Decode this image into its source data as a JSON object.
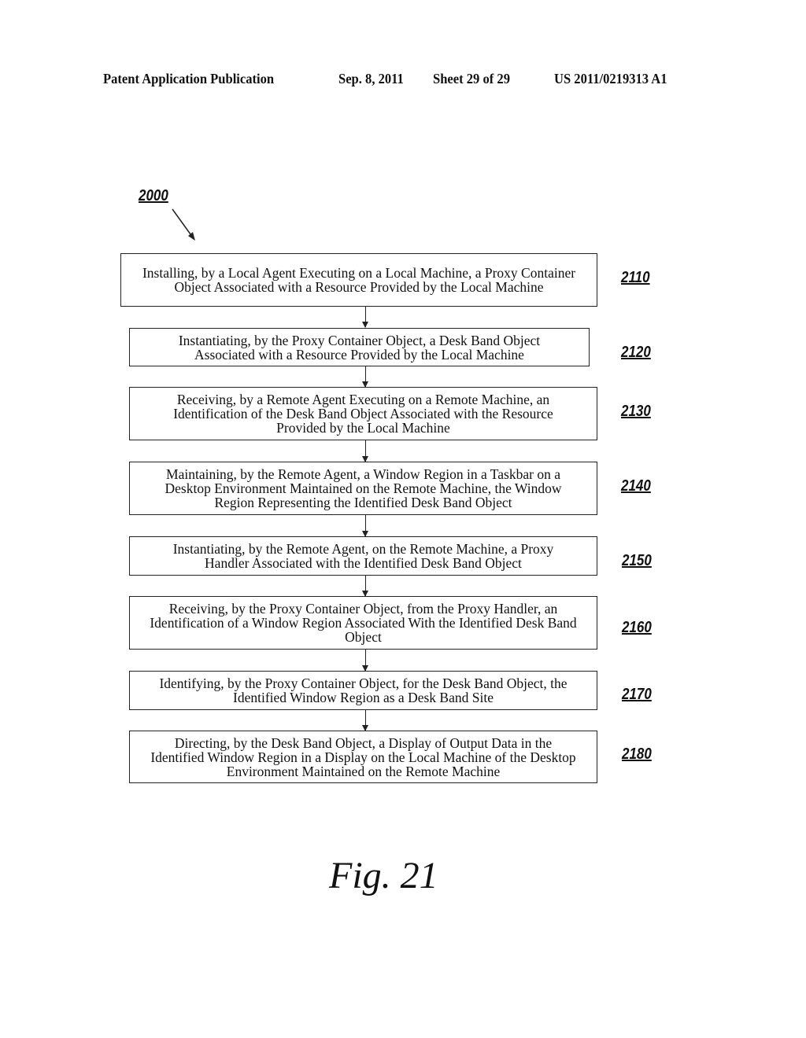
{
  "header": {
    "publication": "Patent Application Publication",
    "date": "Sep. 8, 2011",
    "sheet": "Sheet 29 of 29",
    "number": "US 2011/0219313 A1"
  },
  "diagram": {
    "start_ref": "2000",
    "steps": [
      {
        "ref": "2110",
        "text": "Installing, by a Local Agent Executing on a Local Machine, a Proxy Container Object Associated with a Resource Provided by the Local Machine"
      },
      {
        "ref": "2120",
        "text": "Instantiating, by the Proxy Container Object, a Desk Band Object Associated with a Resource Provided by the Local Machine"
      },
      {
        "ref": "2130",
        "text": "Receiving, by a Remote Agent Executing on a Remote Machine, an Identification of the Desk Band Object Associated with the Resource Provided by the Local Machine"
      },
      {
        "ref": "2140",
        "text": "Maintaining, by the Remote Agent, a Window Region in a Taskbar on a Desktop Environment Maintained on the Remote Machine, the Window Region Representing the Identified Desk Band Object"
      },
      {
        "ref": "2150",
        "text": "Instantiating, by the Remote Agent, on the Remote Machine, a Proxy Handler Associated with the Identified Desk Band Object"
      },
      {
        "ref": "2160",
        "text": "Receiving, by the Proxy Container Object, from the Proxy Handler, an Identification of a Window Region Associated With the Identified Desk Band Object"
      },
      {
        "ref": "2170",
        "text": "Identifying, by the Proxy Container Object, for the Desk Band Object, the Identified Window Region as a Desk Band Site"
      },
      {
        "ref": "2180",
        "text": "Directing, by the Desk Band Object, a Display of Output Data in the Identified Window Region in a Display on the Local Machine of the Desktop Environment Maintained on the Remote Machine"
      }
    ]
  },
  "figure_label": "Fig. 21"
}
